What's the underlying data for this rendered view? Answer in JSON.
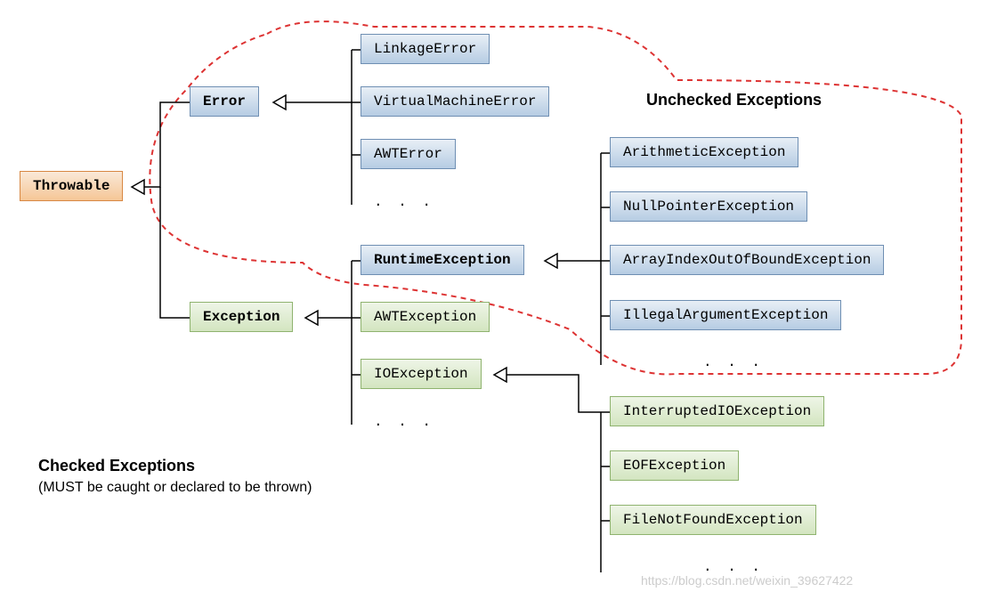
{
  "root": {
    "label": "Throwable"
  },
  "error": {
    "label": "Error",
    "children": [
      "LinkageError",
      "VirtualMachineError",
      "AWTError"
    ],
    "ellipsis": ". . ."
  },
  "exception": {
    "label": "Exception"
  },
  "runtime": {
    "label": "RuntimeException",
    "children": [
      "ArithmeticException",
      "NullPointerException",
      "ArrayIndexOutOfBoundException",
      "IllegalArgumentException"
    ],
    "ellipsis": ". . ."
  },
  "checked": {
    "awt": "AWTException",
    "io": "IOException",
    "ellipsis": ". . ."
  },
  "io_children": {
    "items": [
      "InterruptedIOException",
      "EOFException",
      "FileNotFoundException"
    ],
    "ellipsis": ". . ."
  },
  "labels": {
    "unchecked": "Unchecked Exceptions",
    "checked_title": "Checked Exceptions",
    "checked_sub": "(MUST be caught or declared to be thrown)"
  },
  "watermark": "https://blog.csdn.net/weixin_39627422"
}
